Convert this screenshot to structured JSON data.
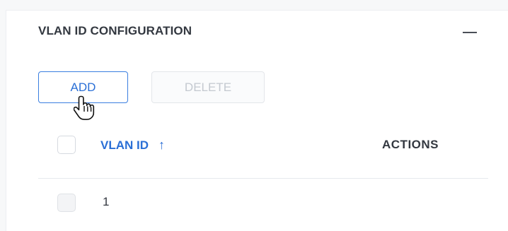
{
  "panel": {
    "title": "VLAN ID CONFIGURATION",
    "collapse_icon": "minus-icon"
  },
  "toolbar": {
    "add_label": "ADD",
    "delete_label": "DELETE",
    "delete_disabled": true
  },
  "table": {
    "columns": {
      "vlan_id": "VLAN ID",
      "sort_glyph": "↑",
      "actions": "ACTIONS"
    },
    "sort": {
      "column": "vlan_id",
      "direction": "ascending"
    },
    "rows": [
      {
        "vlan_id": "1",
        "selectable": false
      }
    ]
  },
  "colors": {
    "accent": "#2a6fd6",
    "text": "#333840",
    "disabled_text": "#c4c9d0",
    "border": "#e6e9ed"
  },
  "icons": {
    "cursor": "hand-pointer-icon",
    "sort": "sort-ascending-icon",
    "collapse": "minus-icon"
  }
}
